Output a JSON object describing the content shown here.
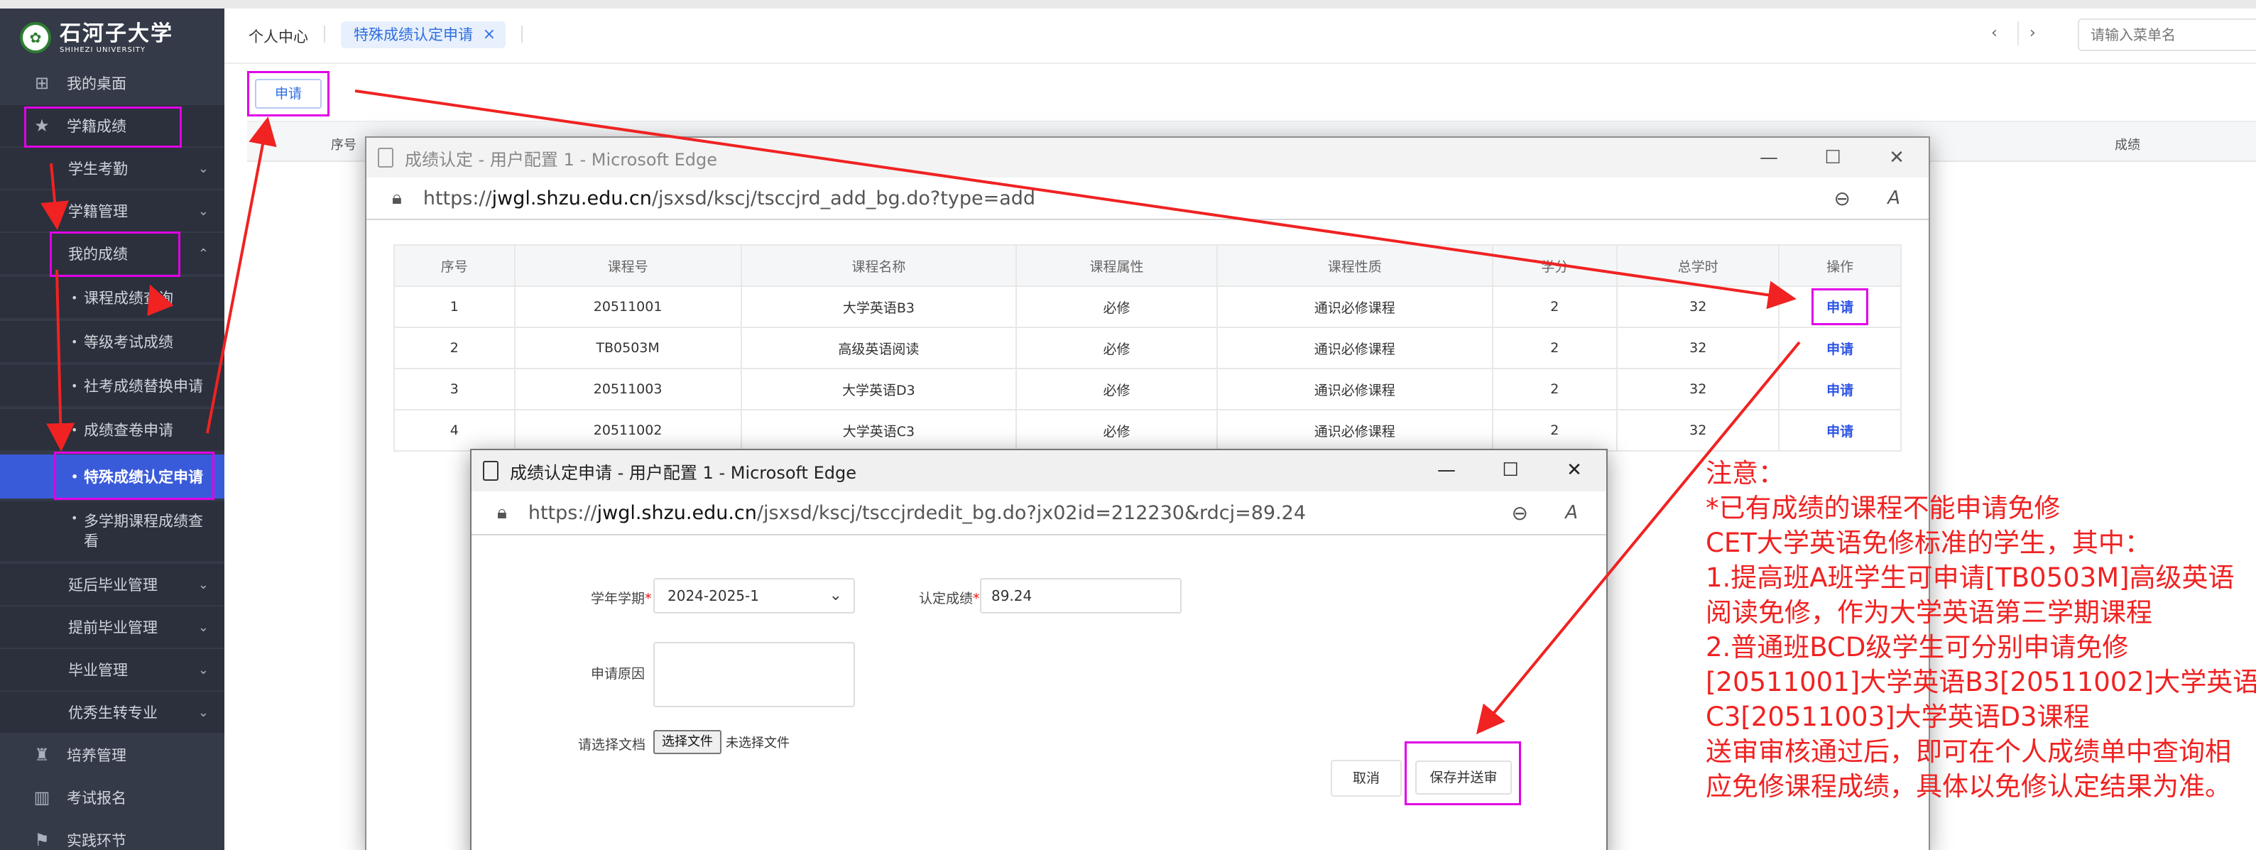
{
  "sidebar": {
    "logo": {
      "cn": "石河子大学",
      "en": "SHIHEZI UNIVERSITY"
    },
    "items": [
      {
        "label": "我的桌面",
        "icon": "windows-icon"
      },
      {
        "label": "学籍成绩",
        "icon": "star-icon"
      },
      {
        "label": "学生考勤"
      },
      {
        "label": "学籍管理"
      },
      {
        "label": "我的成绩"
      },
      {
        "label": "课程成绩查询"
      },
      {
        "label": "等级考试成绩"
      },
      {
        "label": "社考成绩替换申请"
      },
      {
        "label": "成绩查卷申请"
      },
      {
        "label": "特殊成绩认定申请"
      },
      {
        "label": "多学期课程成绩查",
        "label2": "看"
      },
      {
        "label": "延后毕业管理"
      },
      {
        "label": "提前毕业管理"
      },
      {
        "label": "毕业管理"
      },
      {
        "label": "优秀生转专业"
      },
      {
        "label": "培养管理",
        "icon": "person-icon"
      },
      {
        "label": "考试报名",
        "icon": "books-icon"
      },
      {
        "label": "实践环节",
        "icon": "flag-icon"
      }
    ]
  },
  "topbar": {
    "home_tab": "个人中心",
    "active_tab": "特殊成绩认定申请",
    "close_glyph": "×",
    "prev": "‹",
    "next": "›",
    "search_placeholder": "请输入菜单名"
  },
  "main": {
    "apply_button": "申请",
    "bg_headers": {
      "no": "序号",
      "score": "成绩"
    }
  },
  "window1": {
    "title": "成绩认定 - 用户配置 1 - Microsoft Edge",
    "url_prefix": "https://",
    "url_domain": "jwgl.shzu.edu.cn",
    "url_path": "/jsxsd/kscj/tsccjrd_add_bg.do?type=add",
    "headers": [
      "序号",
      "课程号",
      "课程名称",
      "课程属性",
      "课程性质",
      "学分",
      "总学时",
      "操作"
    ],
    "rows": [
      [
        "1",
        "20511001",
        "大学英语B3",
        "必修",
        "通识必修课程",
        "2",
        "32",
        "申请"
      ],
      [
        "2",
        "TB0503M",
        "高级英语阅读",
        "必修",
        "通识必修课程",
        "2",
        "32",
        "申请"
      ],
      [
        "3",
        "20511003",
        "大学英语D3",
        "必修",
        "通识必修课程",
        "2",
        "32",
        "申请"
      ],
      [
        "4",
        "20511002",
        "大学英语C3",
        "必修",
        "通识必修课程",
        "2",
        "32",
        "申请"
      ]
    ]
  },
  "window2": {
    "title": "成绩认定申请 - 用户配置 1 - Microsoft Edge",
    "url_prefix": "https://",
    "url_domain": "jwgl.shzu.edu.cn",
    "url_path": "/jsxsd/kscj/tsccjrdedit_bg.do?jx02id=212230&rdcj=89.24",
    "term_label": "学年学期",
    "term_value": "2024-2025-1",
    "score_label": "认定成绩",
    "score_value": "89.24",
    "reason_label": "申请原因",
    "doc_label": "请选择文档",
    "file_button": "选择文件",
    "file_none": "未选择文件",
    "cancel": "取消",
    "save": "保存并送审"
  },
  "notes": [
    "注意：",
    "*已有成绩的课程不能申请免修",
    "CET大学英语免修标准的学生，其中：",
    "1.提高班A班学生可申请[TB0503M]高级英语",
    "阅读免修，作为大学英语第三学期课程",
    "2.普通班BCD级学生可分别申请免修",
    "[20511001]大学英语B3[20511002]大学英语",
    "C3[20511003]大学英语D3课程",
    "送审审核通过后，即可在个人成绩单中查询相",
    "应免修课程成绩，具体以免修认定结果为准。"
  ],
  "colors": {
    "annotation_magenta": "#e100e6",
    "annotation_red": "#f02222",
    "sidebar_bg": "#343a48",
    "active_blue": "#3a5bd9"
  }
}
